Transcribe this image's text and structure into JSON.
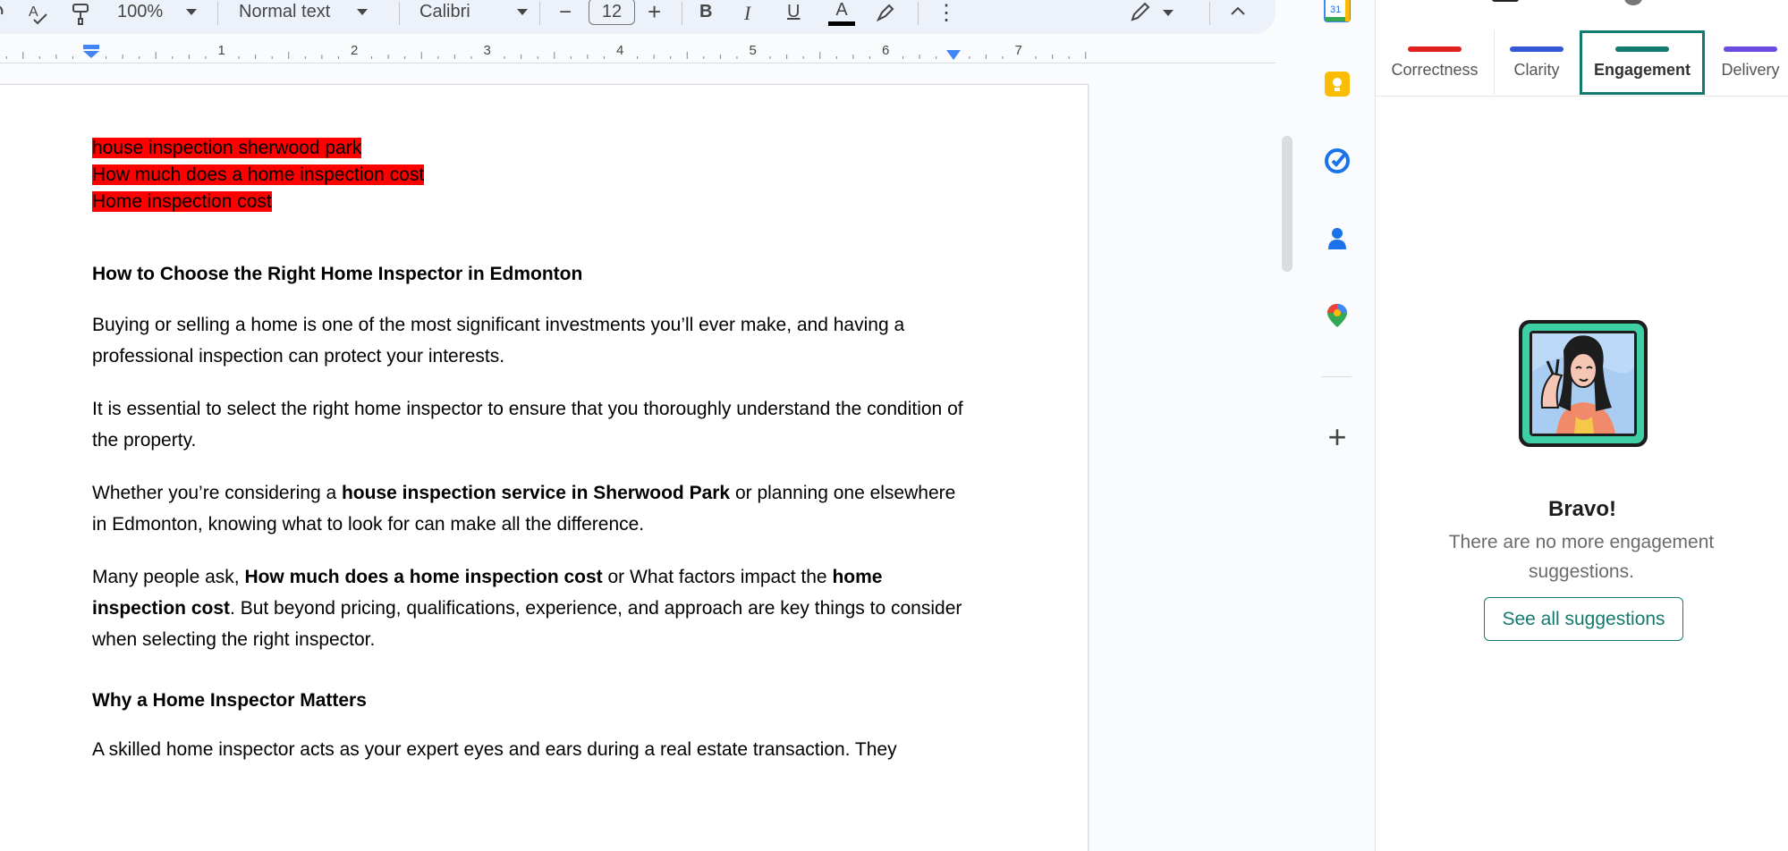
{
  "toolbar": {
    "zoom": "100%",
    "style": "Normal text",
    "font": "Calibri",
    "font_size": "12",
    "minus": "−",
    "plus": "+",
    "bold": "B",
    "italic": "I",
    "underline": "U",
    "text_color": "A",
    "more": "⋮",
    "collapse": "^"
  },
  "ruler": {
    "numbers": [
      "1",
      "2",
      "3",
      "4",
      "5",
      "6",
      "7"
    ]
  },
  "document": {
    "highlighted_lines": [
      "house inspection sherwood park",
      "How much does a home inspection cost",
      "Home inspection cost"
    ],
    "heading1": "How to Choose the Right Home Inspector in Edmonton",
    "para1": "Buying or selling a home is one of the most significant investments you’ll ever make, and having a professional inspection can protect your interests.",
    "para2": "It is essential to select the right home inspector to ensure that you thoroughly understand the condition of the property.",
    "para3": {
      "pre": "Whether you’re considering a ",
      "bold": "house inspection service in Sherwood Park",
      "post": " or planning one elsewhere in Edmonton, knowing what to look for can make all the difference."
    },
    "para4": {
      "pre": "Many people ask, ",
      "bold1": "How much does a home inspection cost",
      "mid": " or What factors impact the ",
      "bold2": "home inspection cost",
      "post": ". But beyond pricing, qualifications, experience, and approach are key things to consider when selecting the right inspector."
    },
    "heading2": "Why a Home Inspector Matters",
    "para5": "A skilled home inspector acts as your expert eyes and ears during a real estate transaction. They"
  },
  "rail": {
    "calendar_day": "31",
    "add": "+"
  },
  "panel": {
    "tabs": [
      {
        "label": "Correctness",
        "color": "#e0201f"
      },
      {
        "label": "Clarity",
        "color": "#3457d5"
      },
      {
        "label": "Engagement",
        "color": "#127a6e"
      },
      {
        "label": "Delivery",
        "color": "#6b4be0"
      }
    ],
    "bravo": "Bravo!",
    "message": "There are no more engagement suggestions.",
    "button": "See all suggestions"
  },
  "colors": {
    "highlight": "#ff0000",
    "accent": "#127a6e"
  }
}
